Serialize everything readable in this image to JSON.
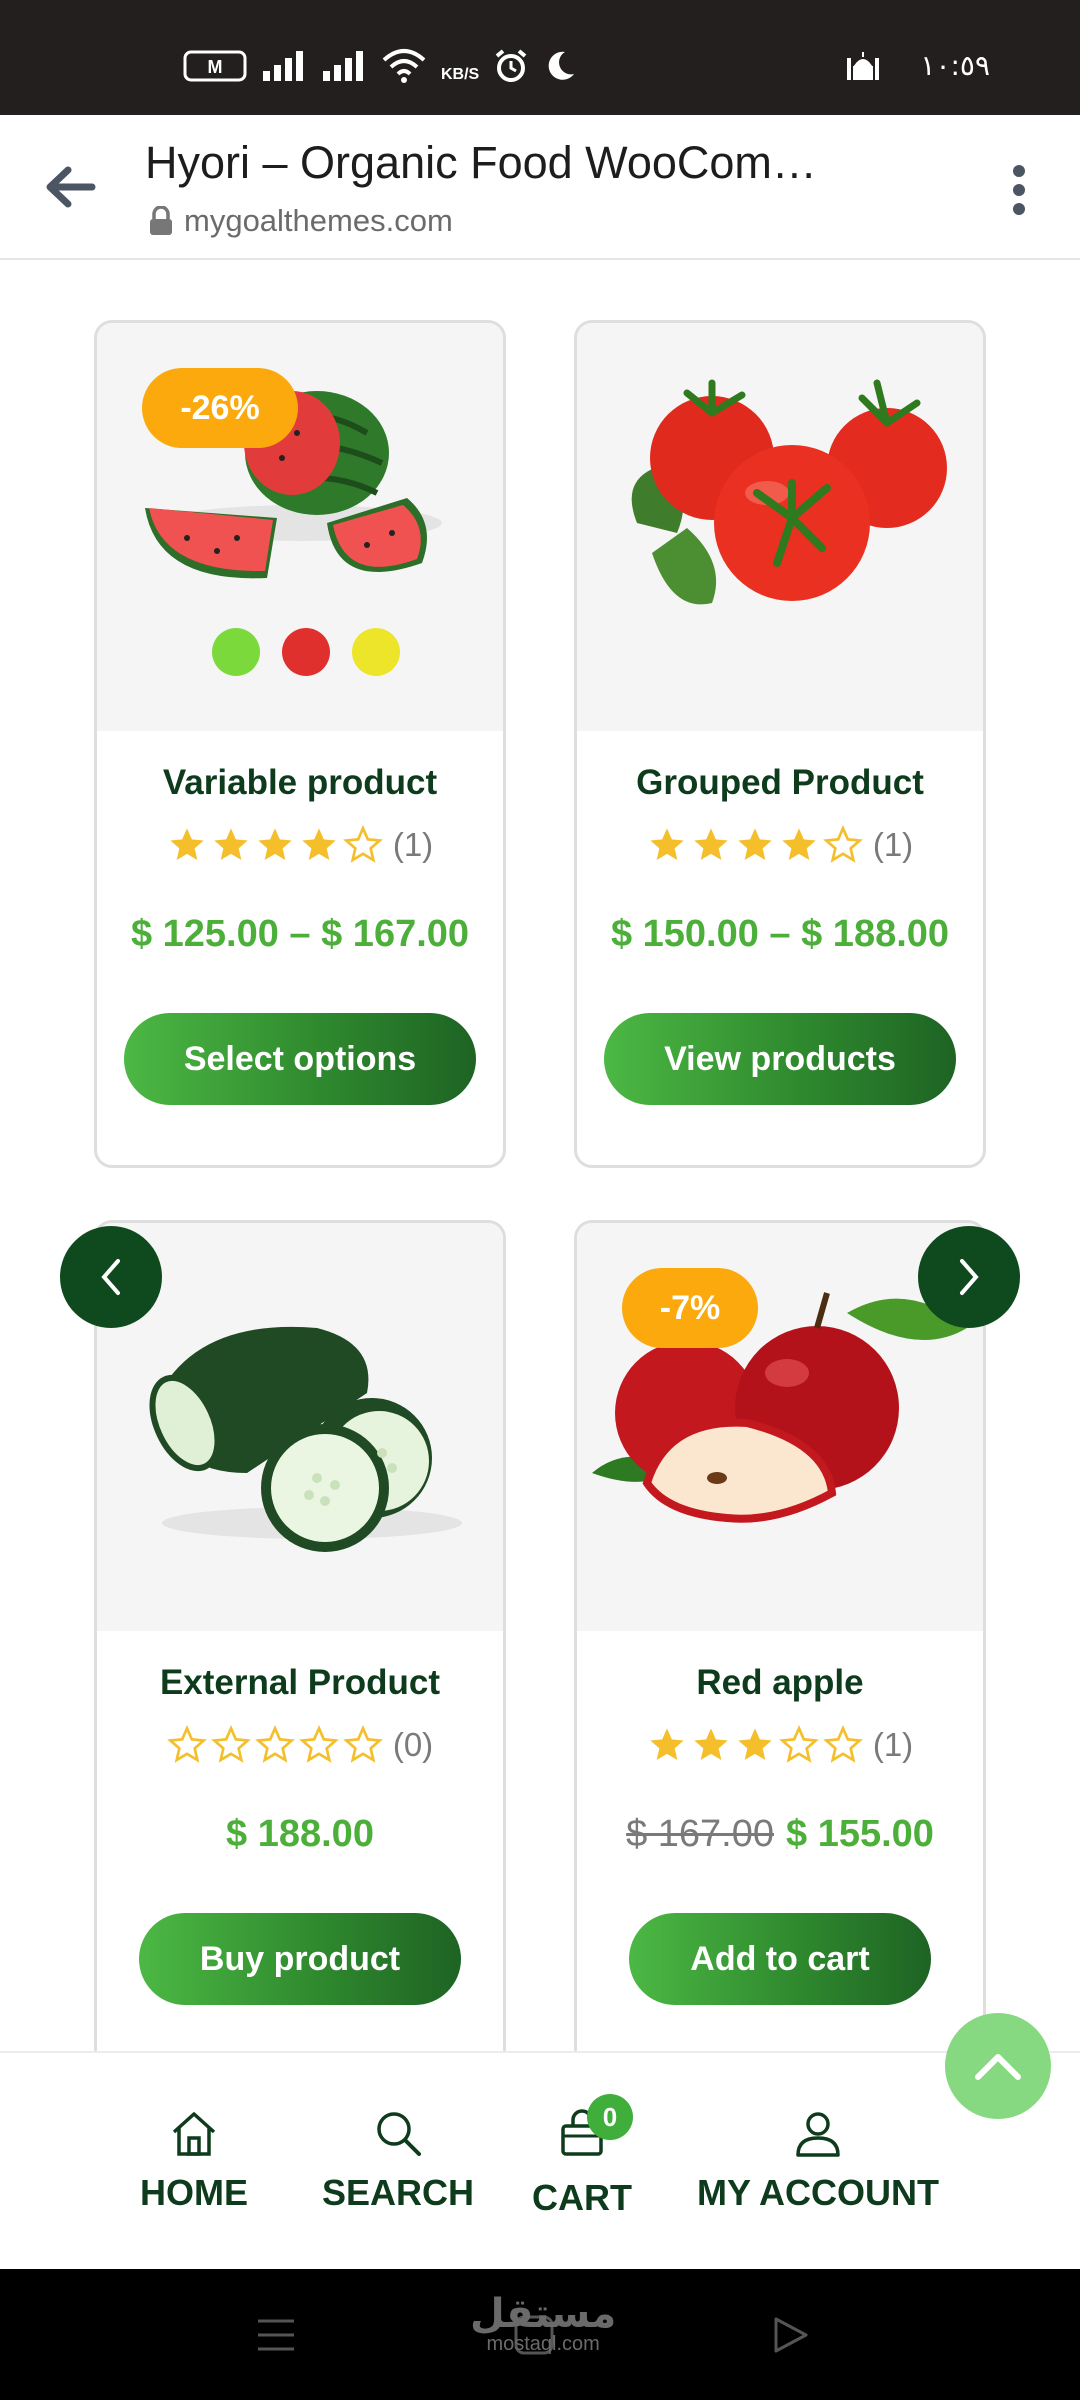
{
  "status_bar": {
    "sim_label": "M",
    "speed_unit": "KB/S",
    "time": "١٠:٥٩"
  },
  "browser": {
    "title": "Hyori – Organic Food WooCom…",
    "url": "mygoalthemes.com",
    "icons": [
      "back-arrow-icon",
      "lock-icon",
      "more-vert-icon"
    ]
  },
  "products": [
    {
      "name": "Variable product",
      "badge": "-26%",
      "rating": 4,
      "rating_count": "(1)",
      "price": "$ 125.00 – $ 167.00",
      "old_price": "",
      "button": "Select options",
      "image": "watermelon",
      "swatches": [
        "#7bd93b",
        "#e0302e",
        "#ede52a"
      ]
    },
    {
      "name": "Grouped Product",
      "badge": "",
      "rating": 4,
      "rating_count": "(1)",
      "price": "$ 150.00 – $ 188.00",
      "old_price": "",
      "button": "View products",
      "image": "tomatoes"
    },
    {
      "name": "External Product",
      "badge": "",
      "rating": 0,
      "rating_count": "(0)",
      "price": "$ 188.00",
      "old_price": "",
      "button": "Buy product",
      "image": "cucumbers"
    },
    {
      "name": "Red apple",
      "badge": "-7%",
      "rating": 3,
      "rating_count": "(1)",
      "price": "$ 155.00",
      "old_price": "$ 167.00",
      "button": "Add to cart",
      "image": "apples"
    }
  ],
  "bottom_nav": {
    "items": [
      {
        "label": "HOME",
        "icon": "home-icon"
      },
      {
        "label": "SEARCH",
        "icon": "search-icon"
      },
      {
        "label": "CART",
        "icon": "cart-icon",
        "badge": "0"
      },
      {
        "label": "MY ACCOUNT",
        "icon": "user-icon"
      }
    ]
  },
  "watermark": {
    "arabic": "مستقل",
    "latin": "mostaql.com"
  },
  "colors": {
    "brand_dark_green": "#0f4a1e",
    "price_green": "#4caf3a",
    "badge_orange": "#fba90c",
    "star_gold": "#f4bf2a"
  }
}
